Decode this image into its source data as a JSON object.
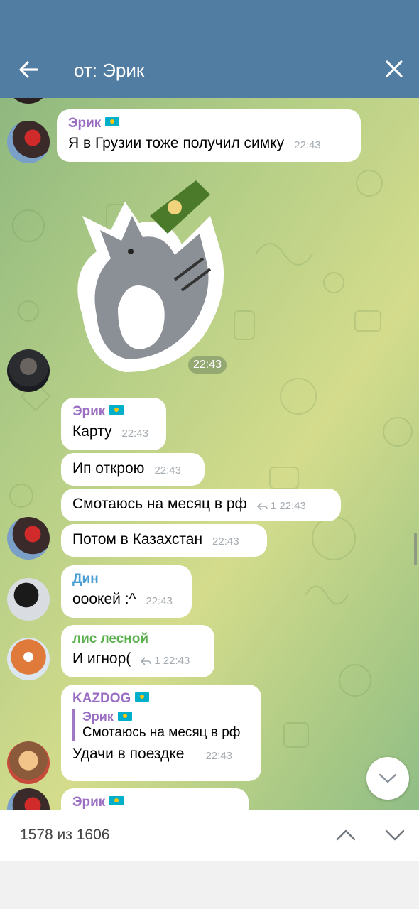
{
  "header": {
    "title": "от: Эрик"
  },
  "messages": {
    "m1": {
      "name": "Эрик",
      "text": "Я в Грузии тоже получил симку",
      "time": "22:43"
    },
    "sticker": {
      "time": "22:43"
    },
    "m2": {
      "name": "Эрик",
      "text": "Карту",
      "time": "22:43"
    },
    "m3": {
      "text": "Ип открою",
      "time": "22:43"
    },
    "m4": {
      "text": "Смотаюсь на месяц в рф",
      "reply_count": "1",
      "time": "22:43"
    },
    "m5": {
      "text": "Потом в Казахстан",
      "time": "22:43"
    },
    "m6": {
      "name": "Дин",
      "text": "ооокей :^",
      "time": "22:43"
    },
    "m7": {
      "name": "лис лесной",
      "text": "И игнор(",
      "reply_count": "1",
      "time": "22:43"
    },
    "m8": {
      "name": "KAZDOG",
      "quote_name": "Эрик",
      "quote_text": "Смотаюсь на месяц в рф",
      "text": "Удачи в поездке",
      "time": "22:43"
    },
    "m9": {
      "name": "Эрик"
    }
  },
  "colors": {
    "header": "#527da3",
    "name_erik": "#9a6ec3",
    "name_din": "#4a9fd4",
    "name_lis": "#5bb14e",
    "flag": "#00afca"
  },
  "footer": {
    "counter": "1578 из 1606"
  },
  "icons": {
    "back": "arrow-left-icon",
    "close": "close-icon",
    "up": "chevron-up-icon",
    "down": "chevron-down-icon",
    "flag": "kazakhstan-flag-icon"
  }
}
